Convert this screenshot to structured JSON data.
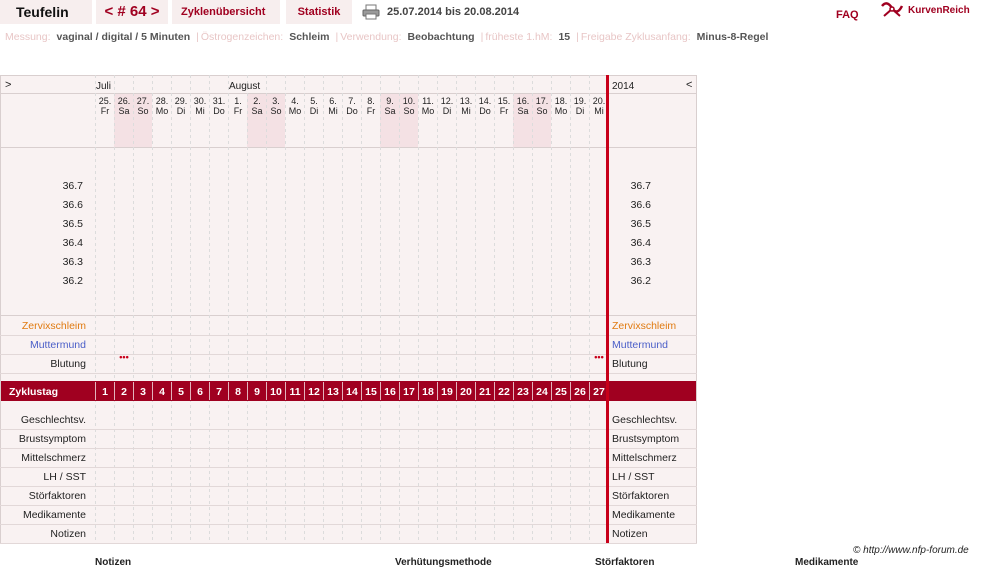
{
  "header": {
    "user": "Teufelin",
    "cycle_nav": "< # 64 >",
    "overview": "Zyklenübersicht",
    "stats": "Statistik",
    "date_range": "25.07.2014 bis 20.08.2014",
    "faq": "FAQ",
    "brand": "KurvenReich",
    "print_icon": "printer-icon",
    "brand_icon": "curve-logo-icon"
  },
  "info": [
    {
      "label": "Messung:",
      "value": "vaginal / digital / 5 Minuten"
    },
    {
      "label": "Östrogenzeichen:",
      "value": "Schleim"
    },
    {
      "label": "Verwendung:",
      "value": "Beobachtung"
    },
    {
      "label": "früheste 1.hM:",
      "value": "15"
    },
    {
      "label": "Freigabe Zyklusanfang:",
      "value": "Minus-8-Regel"
    }
  ],
  "chart": {
    "scroll_left": ">",
    "scroll_right": "<",
    "month_jul": "Juli",
    "month_aug": "August",
    "year": "2014",
    "temp_ticks": [
      "36.7",
      "36.6",
      "36.5",
      "36.4",
      "36.3",
      "36.2"
    ],
    "days": [
      {
        "date": "25.",
        "dow": "Fr"
      },
      {
        "date": "26.",
        "dow": "Sa"
      },
      {
        "date": "27.",
        "dow": "So"
      },
      {
        "date": "28.",
        "dow": "Mo"
      },
      {
        "date": "29.",
        "dow": "Di"
      },
      {
        "date": "30.",
        "dow": "Mi"
      },
      {
        "date": "31.",
        "dow": "Do"
      },
      {
        "date": "1.",
        "dow": "Fr"
      },
      {
        "date": "2.",
        "dow": "Sa"
      },
      {
        "date": "3.",
        "dow": "So"
      },
      {
        "date": "4.",
        "dow": "Mo"
      },
      {
        "date": "5.",
        "dow": "Di"
      },
      {
        "date": "6.",
        "dow": "Mi"
      },
      {
        "date": "7.",
        "dow": "Do"
      },
      {
        "date": "8.",
        "dow": "Fr"
      },
      {
        "date": "9.",
        "dow": "Sa"
      },
      {
        "date": "10.",
        "dow": "So"
      },
      {
        "date": "11.",
        "dow": "Mo"
      },
      {
        "date": "12.",
        "dow": "Di"
      },
      {
        "date": "13.",
        "dow": "Mi"
      },
      {
        "date": "14.",
        "dow": "Do"
      },
      {
        "date": "15.",
        "dow": "Fr"
      },
      {
        "date": "16.",
        "dow": "Sa"
      },
      {
        "date": "17.",
        "dow": "So"
      },
      {
        "date": "18.",
        "dow": "Mo"
      },
      {
        "date": "19.",
        "dow": "Di"
      },
      {
        "date": "20.",
        "dow": "Mi"
      }
    ],
    "cycle_days": [
      "1",
      "2",
      "3",
      "4",
      "5",
      "6",
      "7",
      "8",
      "9",
      "10",
      "11",
      "12",
      "13",
      "14",
      "15",
      "16",
      "17",
      "18",
      "19",
      "20",
      "21",
      "22",
      "23",
      "24",
      "25",
      "26",
      "27"
    ],
    "cycle_row_label": "Zyklustag",
    "obs_rows": [
      {
        "label": "Zervixschleim",
        "color": "#e07a10"
      },
      {
        "label": "Muttermund",
        "color": "#4a5ec8"
      },
      {
        "label": "Blutung",
        "color": "#222222"
      }
    ],
    "bleeding_days": [
      2,
      27
    ],
    "bleeding_mark": "•••",
    "extra_rows": [
      "Geschlechtsv.",
      "Brustsymptom",
      "Mittelschmerz",
      "LH / SST",
      "Störfaktoren",
      "Medikamente",
      "Notizen"
    ],
    "colors": {
      "panel_bg": "#f9f2f2",
      "weekend_bg": "#f4e1e4",
      "cycle_bar": "#a00020",
      "today_line": "#c8001a",
      "grid": "#dcdcdc"
    }
  },
  "footer": {
    "copyright": "© http://www.nfp-forum.de",
    "sections": [
      "Notizen",
      "Verhütungsmethode",
      "Störfaktoren",
      "Medikamente"
    ]
  }
}
